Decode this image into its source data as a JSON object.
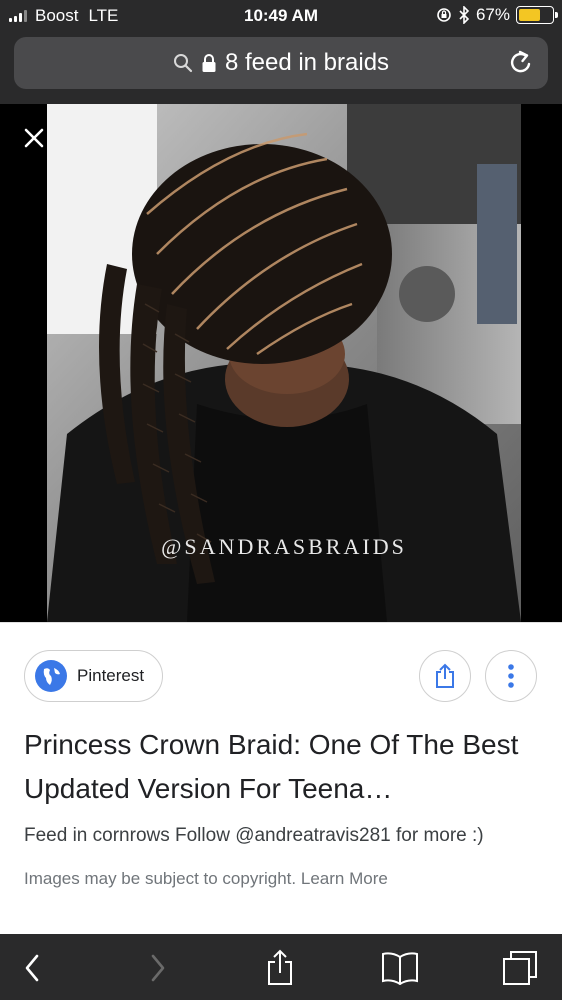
{
  "status_bar": {
    "carrier": "Boost",
    "network": "LTE",
    "time": "10:49 AM",
    "battery_percent_label": "67%",
    "battery_level": 0.67
  },
  "address_bar": {
    "query": "8 feed in braids"
  },
  "image": {
    "watermark": "@SANDRASBRAIDS"
  },
  "result": {
    "source_name": "Pinterest",
    "title": "Princess Crown Braid: One Of The Best Updated Version For Teena…",
    "description": "Feed in cornrows Follow @andreatravis281 for more :)",
    "copyright_notice": "Images may be subject to copyright.",
    "learn_more": "Learn More"
  },
  "colors": {
    "chrome_bg": "#2a2a2b",
    "url_bar_bg": "#4a4a4c",
    "battery_fill": "#f3c623",
    "link_color": "#70757a",
    "globe_blue": "#3b78e7"
  }
}
